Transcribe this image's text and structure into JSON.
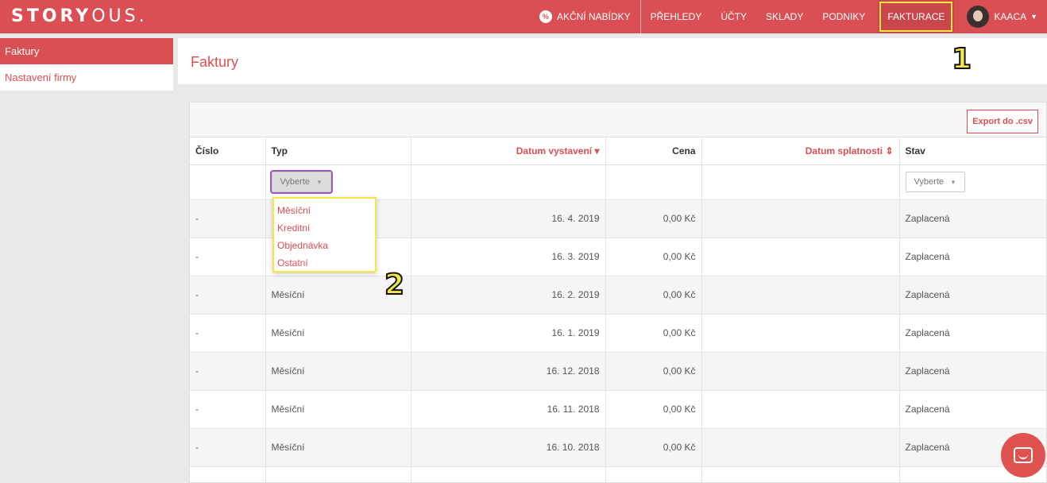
{
  "header": {
    "logo_bold": "STORY",
    "logo_rest": "OUS.",
    "nav": {
      "offers": "AKČNÍ NABÍDKY",
      "overviews": "PŘEHLEDY",
      "accounts": "ÚČTY",
      "stores": "SKLADY",
      "businesses": "PODNIKY",
      "billing": "FAKTURACE",
      "user": "KAACA"
    }
  },
  "sidebar": {
    "items": [
      {
        "label": "Faktury",
        "active": true
      },
      {
        "label": "Nastavení firmy",
        "active": false
      }
    ]
  },
  "page": {
    "title": "Faktury",
    "export_label": "Export do .csv"
  },
  "table": {
    "columns": {
      "number": "Číslo",
      "type": "Typ",
      "issue_date": "Datum vystavení",
      "price": "Cena",
      "due_date": "Datum splatnosti",
      "status": "Stav"
    },
    "filter_placeholder": "Vyberte",
    "type_options": [
      "Měsíční",
      "Kreditní",
      "Objednávka",
      "Ostatní"
    ],
    "rows": [
      {
        "number": "-",
        "type": "",
        "issue_date": "16. 4. 2019",
        "price": "0,00 Kč",
        "due_date": "",
        "status": "Zaplacená"
      },
      {
        "number": "-",
        "type": "",
        "issue_date": "16. 3. 2019",
        "price": "0,00 Kč",
        "due_date": "",
        "status": "Zaplacená"
      },
      {
        "number": "-",
        "type": "Měsíční",
        "issue_date": "16. 2. 2019",
        "price": "0,00 Kč",
        "due_date": "",
        "status": "Zaplacená"
      },
      {
        "number": "-",
        "type": "Měsíční",
        "issue_date": "16. 1. 2019",
        "price": "0,00 Kč",
        "due_date": "",
        "status": "Zaplacená"
      },
      {
        "number": "-",
        "type": "Měsíční",
        "issue_date": "16. 12. 2018",
        "price": "0,00 Kč",
        "due_date": "",
        "status": "Zaplacená"
      },
      {
        "number": "-",
        "type": "Měsíční",
        "issue_date": "16. 11. 2018",
        "price": "0,00 Kč",
        "due_date": "",
        "status": "Zaplacená"
      },
      {
        "number": "-",
        "type": "Měsíční",
        "issue_date": "16. 10. 2018",
        "price": "0,00 Kč",
        "due_date": "",
        "status": "Zaplacená"
      },
      {
        "number": "",
        "type": "",
        "issue_date": "",
        "price": "",
        "due_date": "",
        "status": ""
      }
    ]
  },
  "annotations": {
    "marker1": "1",
    "marker2": "2"
  },
  "colors": {
    "brand": "#d94f53",
    "highlight": "#f5e642"
  }
}
